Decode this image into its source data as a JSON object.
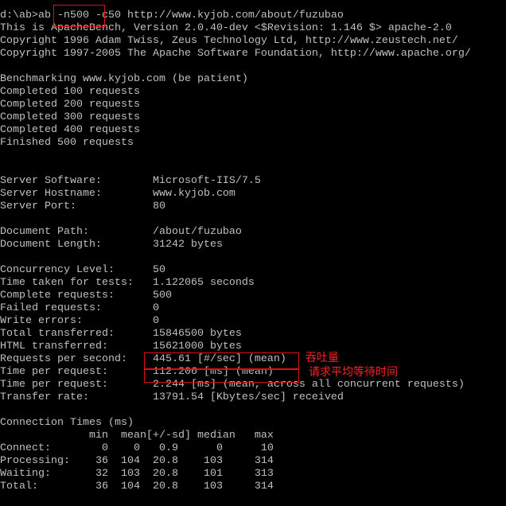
{
  "terminal": {
    "background": "#000000",
    "foreground": "#c0c0c0",
    "lines": [
      "d:\\ab>ab -n500 -c50 http://www.kyjob.com/about/fuzubao",
      "This is ApacheBench, Version 2.0.40-dev <$Revision: 1.146 $> apache-2.0",
      "Copyright 1996 Adam Twiss, Zeus Technology Ltd, http://www.zeustech.net/",
      "Copyright 1997-2005 The Apache Software Foundation, http://www.apache.org/",
      "",
      "Benchmarking www.kyjob.com (be patient)",
      "Completed 100 requests",
      "Completed 200 requests",
      "Completed 300 requests",
      "Completed 400 requests",
      "Finished 500 requests",
      "",
      "",
      "Server Software:        Microsoft-IIS/7.5",
      "Server Hostname:        www.kyjob.com",
      "Server Port:            80",
      "",
      "Document Path:          /about/fuzubao",
      "Document Length:        31242 bytes",
      "",
      "Concurrency Level:      50",
      "Time taken for tests:   1.122065 seconds",
      "Complete requests:      500",
      "Failed requests:        0",
      "Write errors:           0",
      "Total transferred:      15846500 bytes",
      "HTML transferred:       15621000 bytes",
      "Requests per second:    445.61 [#/sec] (mean)",
      "Time per request:       112.206 [ms] (mean)",
      "Time per request:       2.244 [ms] (mean, across all concurrent requests)",
      "Transfer rate:          13791.54 [Kbytes/sec] received",
      "",
      "Connection Times (ms)",
      "              min  mean[+/-sd] median   max",
      "Connect:        0    0   0.9      0      10",
      "Processing:    36  104  20.8    103     314",
      "Waiting:       32  103  20.8    101     313",
      "Total:         36  104  20.8    103     314"
    ]
  },
  "annotations": {
    "color": "#e01010",
    "throughput_label": "吞吐量",
    "avg_wait_label": "请求平均等待时间"
  }
}
